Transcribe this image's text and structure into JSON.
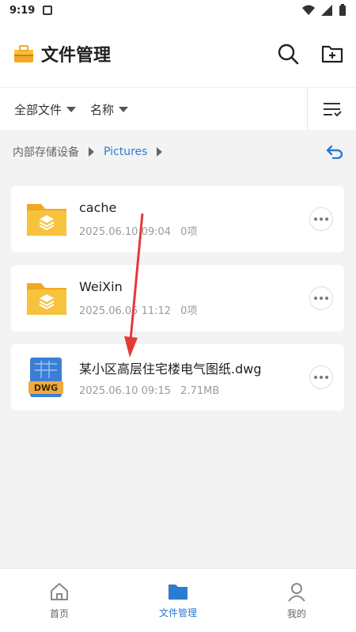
{
  "status_bar": {
    "time": "9:19"
  },
  "header": {
    "title": "文件管理"
  },
  "toolbar": {
    "filter_label": "全部文件",
    "sort_label": "名称"
  },
  "breadcrumb": {
    "items": [
      "内部存储设备",
      "Pictures"
    ]
  },
  "files": [
    {
      "name": "cache",
      "date": "2025.06.10 09:04",
      "detail": "0项",
      "icon": "folder-icon"
    },
    {
      "name": "WeiXin",
      "date": "2025.06.05 11:12",
      "detail": "0项",
      "icon": "folder-icon"
    },
    {
      "name": "某小区高层住宅楼电气图纸.dwg",
      "date": "2025.06.10 09:15",
      "detail": "2.71MB",
      "icon": "dwg-file-icon",
      "badge": "DWG"
    }
  ],
  "bottom_nav": {
    "tabs": [
      "首页",
      "文件管理",
      "我的"
    ],
    "active_index": 1
  },
  "colors": {
    "accent": "#2a7bd1",
    "folder": "#f7c23c",
    "annotation_arrow": "#e53935"
  }
}
